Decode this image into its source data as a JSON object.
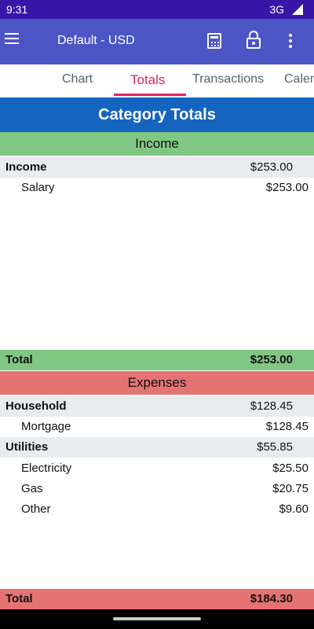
{
  "status_bar": {
    "time": "9:31",
    "network": "3G"
  },
  "app_bar": {
    "title": "Default - USD"
  },
  "tabs": [
    {
      "label": "Chart"
    },
    {
      "label": "Totals"
    },
    {
      "label": "Transactions"
    },
    {
      "label": "Calen"
    }
  ],
  "heading": "Category Totals",
  "income": {
    "title": "Income",
    "category": {
      "label": "Income",
      "amount": "$253.00"
    },
    "items": [
      {
        "label": "Salary",
        "amount": "$253.00"
      }
    ],
    "total": {
      "label": "Total",
      "amount": "$253.00"
    }
  },
  "expenses": {
    "title": "Expenses",
    "household": {
      "label": "Household",
      "amount": "$128.45"
    },
    "mortgage": {
      "label": "Mortgage",
      "amount": "$128.45"
    },
    "utilities": {
      "label": "Utilities",
      "amount": "$55.85"
    },
    "electricity": {
      "label": "Electricity",
      "amount": "$25.50"
    },
    "gas": {
      "label": "Gas",
      "amount": "$20.75"
    },
    "other": {
      "label": "Other",
      "amount": "$9.60"
    },
    "total": {
      "label": "Total",
      "amount": "$184.30"
    }
  },
  "colors": {
    "status_bar": "#3a16a8",
    "app_bar": "#4c55c4",
    "accent": "#e0245e",
    "heading": "#1565c0",
    "income": "#81c784",
    "expense": "#e57373"
  }
}
